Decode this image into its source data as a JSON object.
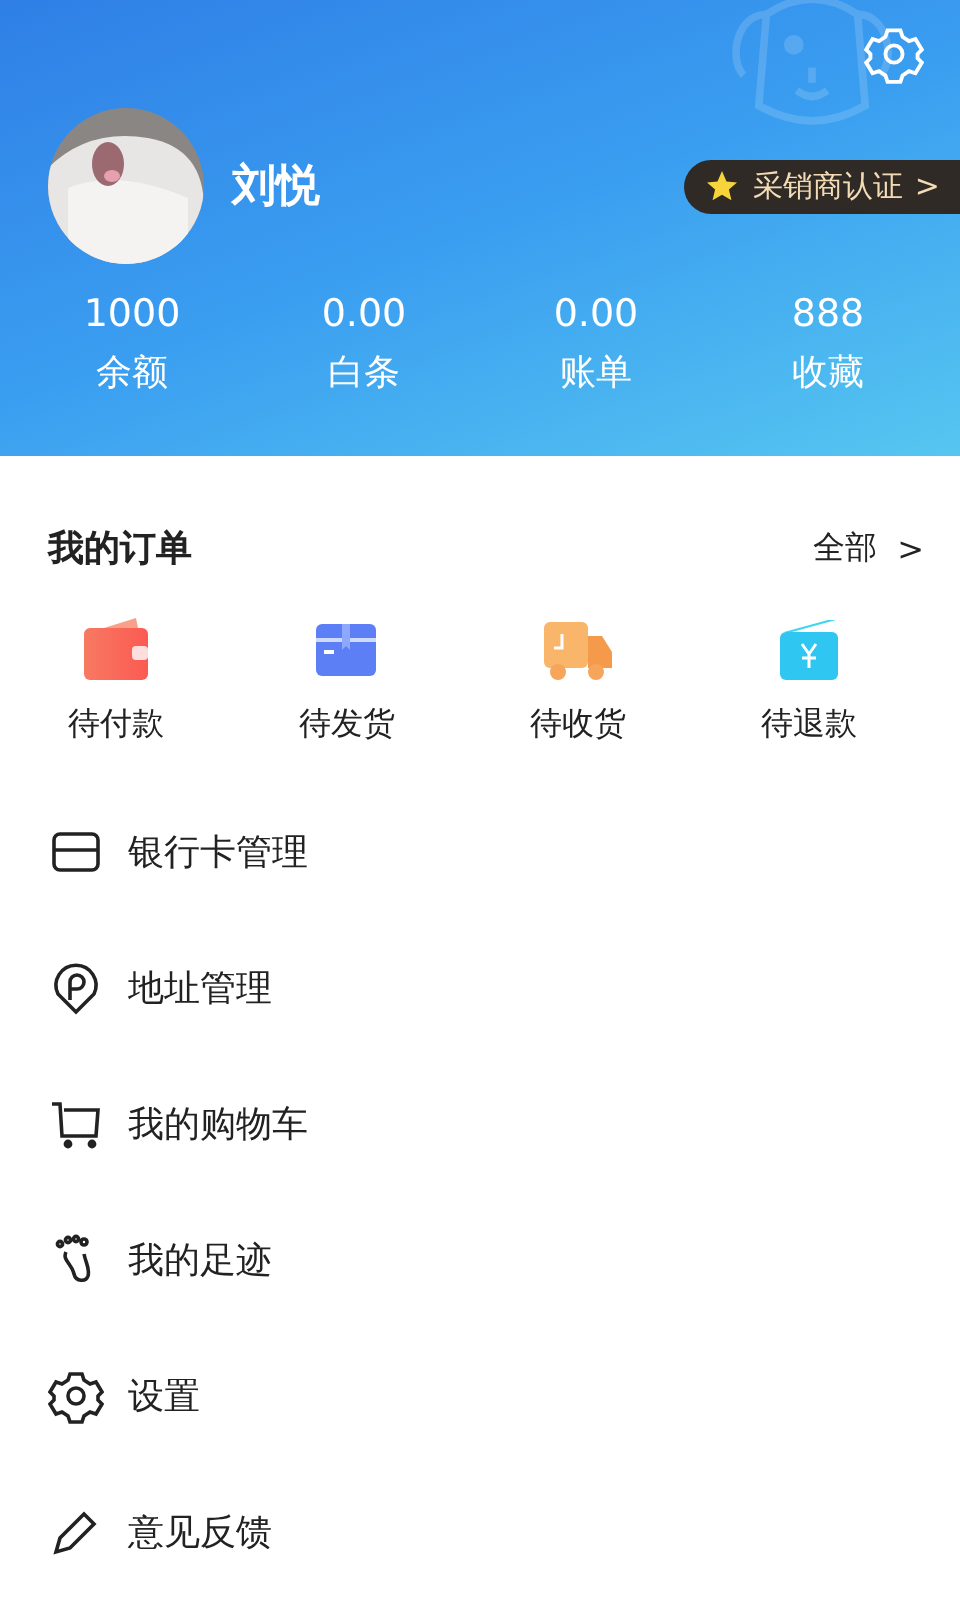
{
  "profile": {
    "name": "刘悦",
    "badge": {
      "label": "采销商认证",
      "chevron": ">"
    }
  },
  "stats": [
    {
      "value": "1000",
      "label": "余额"
    },
    {
      "value": "0.00",
      "label": "白条"
    },
    {
      "value": "0.00",
      "label": "账单"
    },
    {
      "value": "888",
      "label": "收藏"
    }
  ],
  "orders": {
    "title": "我的订单",
    "all_link": "全部",
    "all_chevron": ">",
    "items": [
      {
        "kind": "wallet",
        "label": "待付款"
      },
      {
        "kind": "box",
        "label": "待发货"
      },
      {
        "kind": "truck",
        "label": "待收货"
      },
      {
        "kind": "refund",
        "label": "待退款"
      }
    ]
  },
  "menu": [
    {
      "kind": "card",
      "label": "银行卡管理"
    },
    {
      "kind": "location",
      "label": "地址管理"
    },
    {
      "kind": "cart",
      "label": "我的购物车"
    },
    {
      "kind": "footprint",
      "label": "我的足迹"
    },
    {
      "kind": "gear",
      "label": "设置"
    },
    {
      "kind": "pencil",
      "label": "意见反馈"
    }
  ]
}
